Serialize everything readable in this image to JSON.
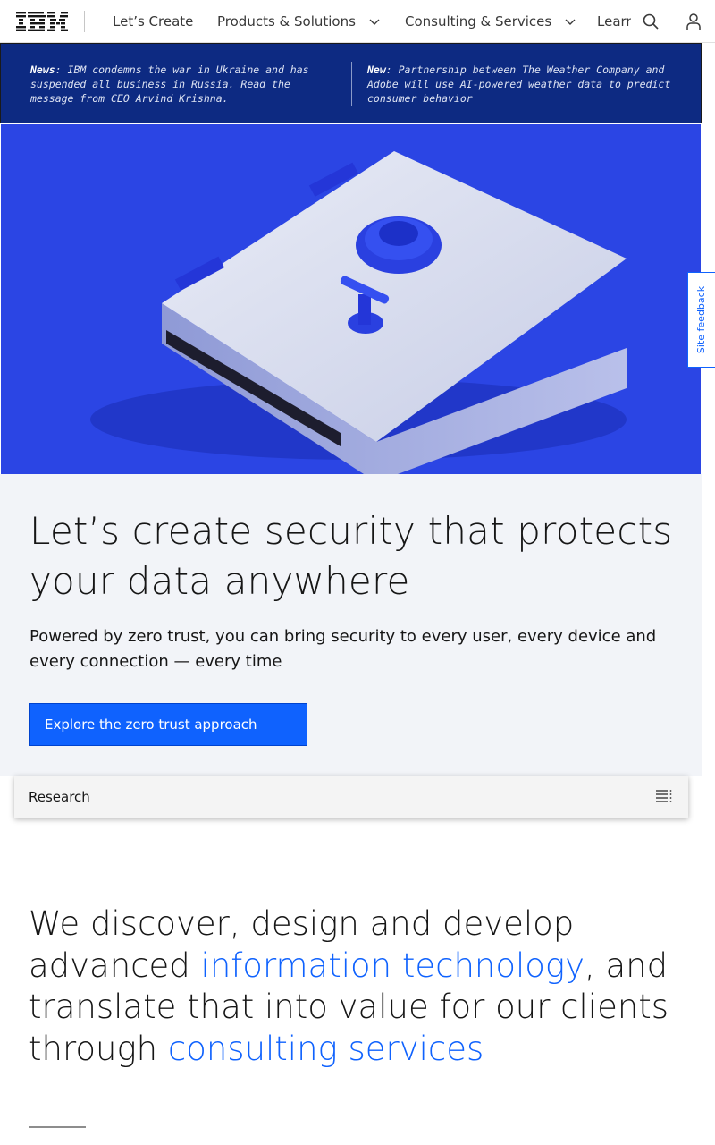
{
  "nav": {
    "logo_text": "IBM",
    "items": [
      {
        "label": "Let’s Create",
        "has_menu": false
      },
      {
        "label": "Products & Solutions",
        "has_menu": true
      },
      {
        "label": "Consulting & Services",
        "has_menu": true
      },
      {
        "label": "Learn",
        "has_menu": false
      }
    ],
    "icons": [
      "search-icon",
      "user-icon",
      "chevron-down-icon"
    ]
  },
  "news": [
    {
      "tag": "News",
      "text": ": IBM condemns the war in Ukraine and has suspended all business in Russia. Read the message from CEO Arvind Krishna."
    },
    {
      "tag": "New",
      "text": ": Partnership between The Weather Company and Adobe will use AI-powered weather data to predict consumer behavior"
    }
  ],
  "hero": {
    "title": "Let’s create security that protects your data anywhere",
    "subtitle": "Powered by zero trust, you can bring security to every user, every device and every connection — every time",
    "cta_label": "Explore the zero trust approach"
  },
  "feedback_label": "Site feedback",
  "research": {
    "label": "Research",
    "icon": "list-menu-icon"
  },
  "lead": {
    "part1": "We discover, design and develop advanced ",
    "link1": "information technology",
    "part2": ", and translate that into value for our clients through ",
    "link2": "consulting services"
  },
  "colors": {
    "accent": "#0f62fe",
    "newsbar": "#0d2a82",
    "panel": "#f2f4f8"
  }
}
